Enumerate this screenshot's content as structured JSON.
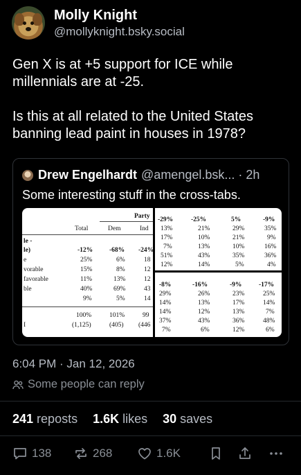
{
  "author": {
    "name": "Molly Knight",
    "handle": "@mollyknight.bsky.social"
  },
  "post": {
    "paragraphs": [
      "Gen X is at +5 support for ICE while millennials are at -25.",
      "Is this at all related to the United States banning lead paint in houses in 1978?"
    ]
  },
  "quote": {
    "name": "Drew Engelhardt",
    "handle": "@amengel.bsk...",
    "dot": "·",
    "time": "2h",
    "text": "Some interesting stuff in the cross-tabs.",
    "table_left": {
      "header_party": "Party",
      "col_total": "Total",
      "col_dem": "Dem",
      "col_ind": "Ind",
      "row_labels": [
        "le -",
        "le)",
        "e",
        "vorable",
        "favorable",
        "ble",
        "",
        "",
        "I"
      ],
      "net_row": [
        "-12%",
        "-68%",
        "-24%"
      ],
      "rows": [
        [
          "25%",
          "6%",
          "18"
        ],
        [
          "15%",
          "8%",
          "12"
        ],
        [
          "11%",
          "13%",
          "12"
        ],
        [
          "40%",
          "69%",
          "43"
        ],
        [
          "9%",
          "5%",
          "14"
        ]
      ],
      "totals": [
        "100%",
        "101%",
        "99"
      ],
      "counts": [
        "(1,125)",
        "(405)",
        "(446"
      ]
    },
    "table_top_right": {
      "net": [
        "-29%",
        "-25%",
        "5%",
        "-9%"
      ],
      "rows": [
        [
          "13%",
          "21%",
          "29%",
          "35%"
        ],
        [
          "17%",
          "10%",
          "21%",
          "9%"
        ],
        [
          "7%",
          "13%",
          "10%",
          "16%"
        ],
        [
          "51%",
          "43%",
          "35%",
          "36%"
        ],
        [
          "12%",
          "14%",
          "5%",
          "4%"
        ]
      ]
    },
    "table_bottom_right": {
      "net": [
        "-8%",
        "-16%",
        "-9%",
        "-17%"
      ],
      "rows": [
        [
          "29%",
          "26%",
          "23%",
          "25%"
        ],
        [
          "14%",
          "13%",
          "17%",
          "14%"
        ],
        [
          "14%",
          "12%",
          "13%",
          "7%"
        ],
        [
          "37%",
          "43%",
          "36%",
          "48%"
        ],
        [
          "7%",
          "6%",
          "12%",
          "6%"
        ]
      ]
    }
  },
  "meta": {
    "timestamp": "6:04 PM · Jan 12, 2026",
    "reply_setting": "Some people can reply"
  },
  "stats": {
    "reposts_count": "241",
    "reposts_label": "reposts",
    "likes_count": "1.6K",
    "likes_label": "likes",
    "saves_count": "30",
    "saves_label": "saves"
  },
  "actions": {
    "reply_count": "138",
    "repost_count": "268",
    "like_count": "1.6K",
    "icons": [
      "reply-icon",
      "repost-icon",
      "like-icon",
      "bookmark-icon",
      "share-icon",
      "more-icon"
    ]
  }
}
